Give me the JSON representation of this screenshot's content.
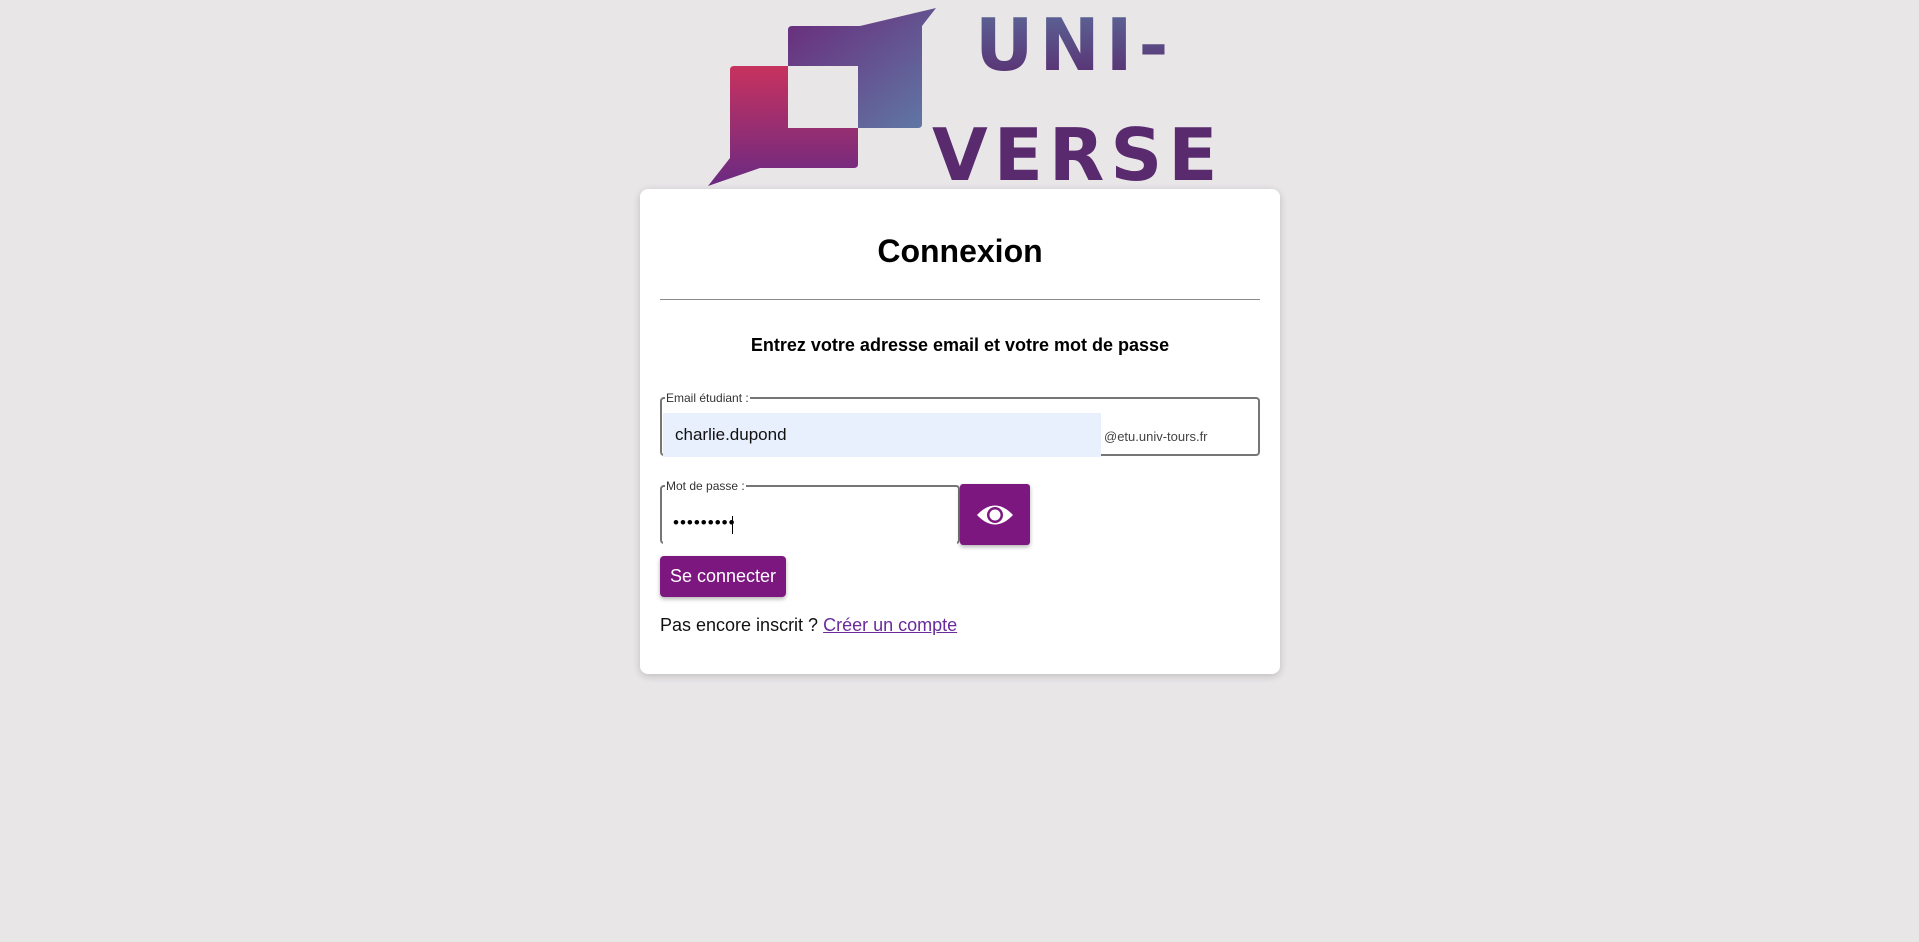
{
  "logo": {
    "line1": "UNI-",
    "line2": "VERSE"
  },
  "login": {
    "title": "Connexion",
    "subtitle": "Entrez votre adresse email et votre mot de passe",
    "email_legend": "Email étudiant :",
    "email_value": "charlie.dupond",
    "email_domain": "@etu.univ-tours.fr",
    "password_legend": "Mot de passe :",
    "password_value": "•••••••••",
    "submit_label": "Se connecter",
    "register_prompt": "Pas encore inscrit ?",
    "register_link": "Créer un compte"
  },
  "colors": {
    "accent": "#7d1780",
    "background": "#e8e6e7",
    "autofill": "#e8f0fe",
    "link": "#6a2a9c"
  },
  "icons": {
    "password_toggle": "eye-icon"
  }
}
